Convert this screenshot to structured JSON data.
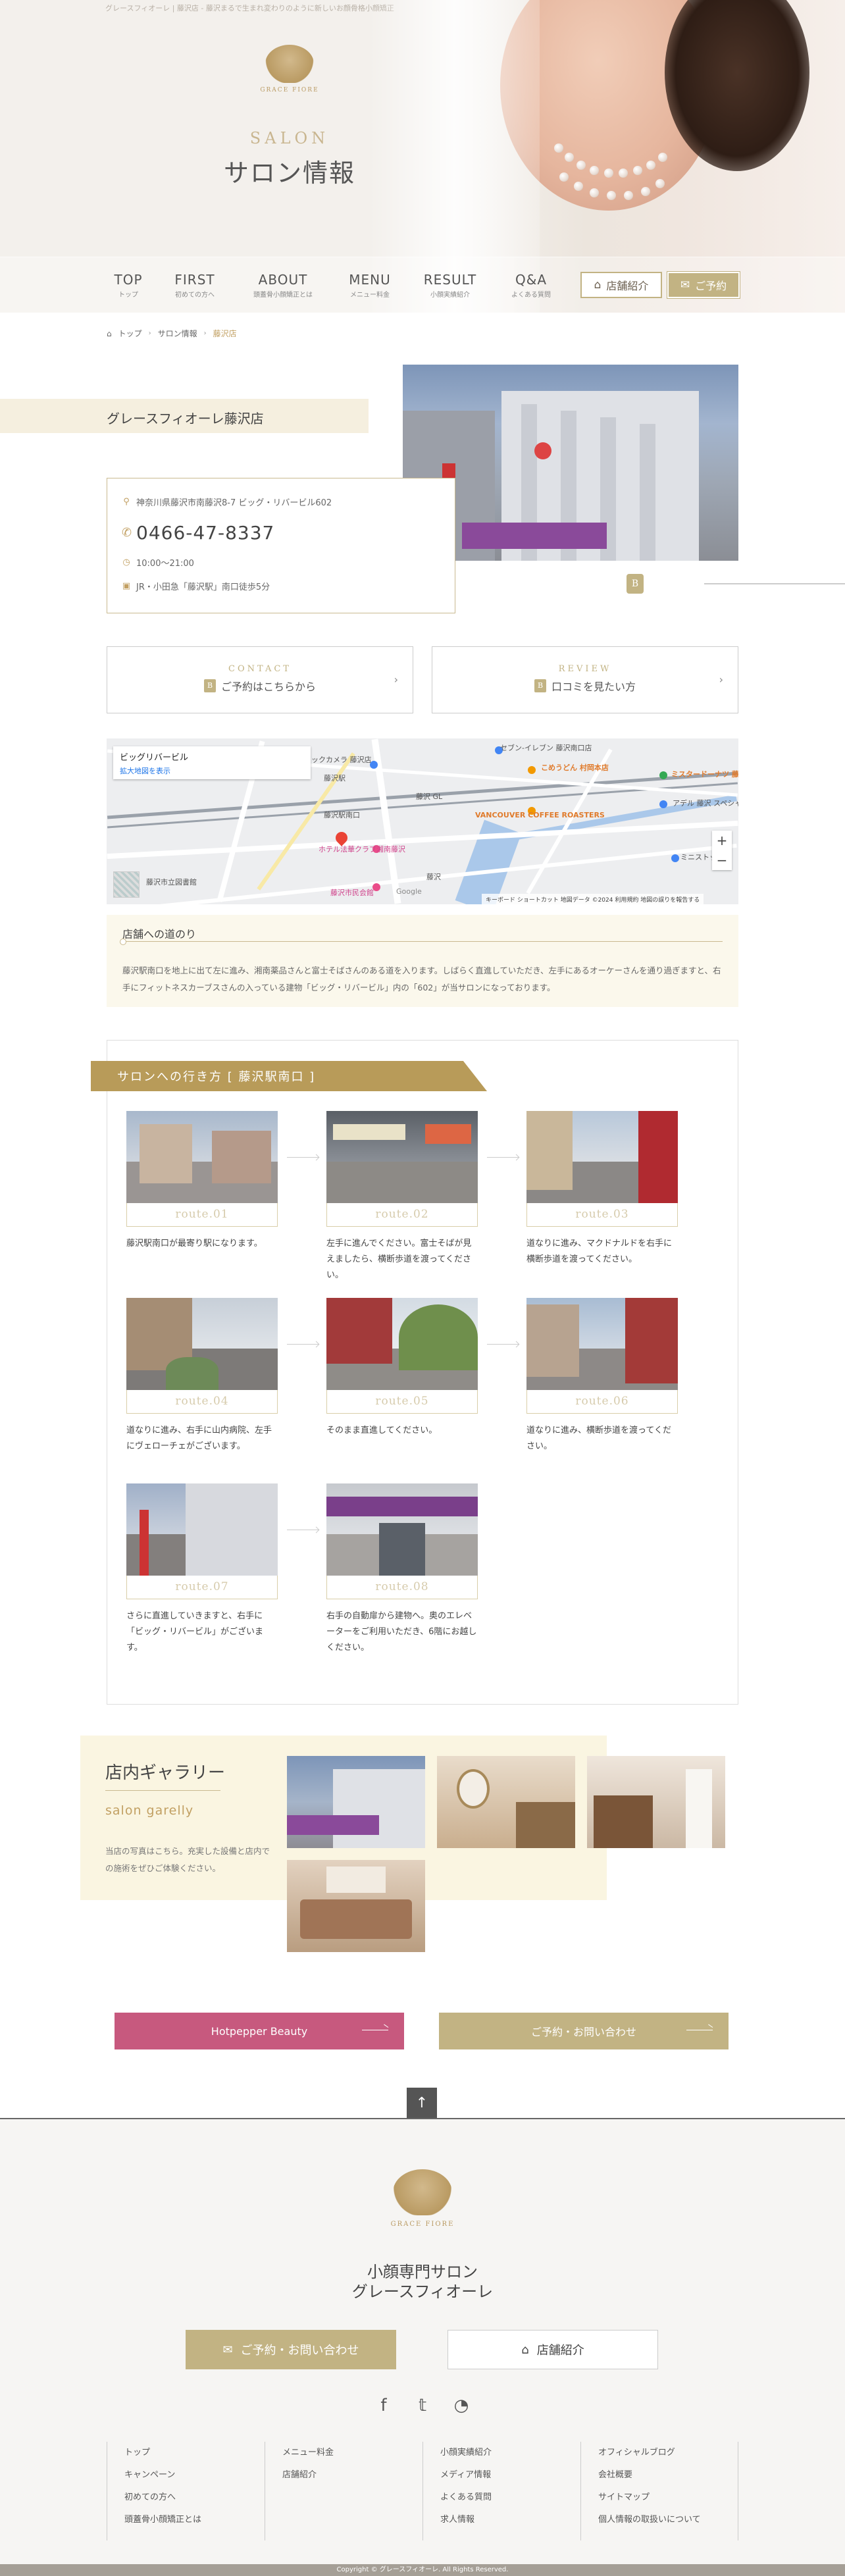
{
  "hero": {
    "tagline": "グレースフィオーレ | 藤沢店 - 藤沢まるで生まれ変わりのように新しいお顔骨格小顔矯正",
    "logo_text": "GRACE FIORE",
    "title_en": "SALON",
    "title_jp": "サロン情報"
  },
  "nav": {
    "items": [
      {
        "main": "TOP",
        "sub": "トップ"
      },
      {
        "main": "FIRST",
        "sub": "初めての方へ"
      },
      {
        "main": "ABOUT",
        "sub": "頭蓋骨小顔矯正とは"
      },
      {
        "main": "MENU",
        "sub": "メニュー料金"
      },
      {
        "main": "RESULT",
        "sub": "小顔実績紹介"
      },
      {
        "main": "Q&A",
        "sub": "よくある質問"
      }
    ],
    "shop_label": "店舗紹介",
    "reserve_label": "ご予約"
  },
  "breadcrumb": {
    "home": "トップ",
    "parent": "サロン情報",
    "current": "藤沢店"
  },
  "shop": {
    "name": "グレースフィオーレ藤沢店",
    "address": "神奈川県藤沢市南藤沢8-7 ビッグ・リバービル602",
    "tel": "0466-47-8337",
    "hours": "10:00〜21:00",
    "access": "JR・小田急「藤沢駅」南口徒歩5分",
    "photo_badge": "B"
  },
  "cta": {
    "contact_en": "CONTACT",
    "contact_jp": "ご予約はこちらから",
    "review_en": "REVIEW",
    "review_jp": "口コミを見たい方",
    "badge": "B"
  },
  "map": {
    "place_name": "ビッグリバービル",
    "enlarge": "拡大地図を表示",
    "footer": "キーボード ショートカット  地図データ ©2024  利用規約  地図の誤りを報告する",
    "labels": [
      "セブン-イレブン 藤沢南口店",
      "ビックカメラ 藤沢店",
      "藤沢駅",
      "藤沢駅南口",
      "藤沢 GL",
      "こめうどん 村岡本店",
      "ミスタードーナツ 藤沢店",
      "VANCOUVER COFFEE ROASTERS",
      "アデル 藤沢 スペシャルショップ",
      "ホテル法華クラブ湘南藤沢",
      "藤沢市立図書館",
      "藤沢市民会館",
      "藤沢",
      "ミニストップ",
      "Google"
    ]
  },
  "route_desc": {
    "title": "店舗への道のり",
    "text": "藤沢駅南口を地上に出て左に進み、湘南薬品さんと富士そばさんのある道を入ります。しばらく直進していただき、左手にあるオーケーさんを通り過ぎますと、右手にフィットネスカーブスさんの入っている建物「ビッグ・リバービル」内の「602」が当サロンになっております。"
  },
  "steps": {
    "heading": "サロンへの行き方 [ 藤沢駅南口 ]",
    "items": [
      {
        "label": "route.01",
        "text": "藤沢駅南口が最寄り駅になります。"
      },
      {
        "label": "route.02",
        "text": "左手に進んでください。富士そばが見えましたら、横断歩道を渡ってください。"
      },
      {
        "label": "route.03",
        "text": "道なりに進み、マクドナルドを右手に横断歩道を渡ってください。"
      },
      {
        "label": "route.04",
        "text": "道なりに進み、右手に山内病院、左手にヴェローチェがございます。"
      },
      {
        "label": "route.05",
        "text": "そのまま直進してください。"
      },
      {
        "label": "route.06",
        "text": "道なりに進み、横断歩道を渡ってください。"
      },
      {
        "label": "route.07",
        "text": "さらに直進していきますと、右手に「ビッグ・リバービル」がございます。"
      },
      {
        "label": "route.08",
        "text": "右手の自動扉から建物へ。奥のエレベーターをご利用いただき、6階にお越しください。"
      }
    ]
  },
  "gallery": {
    "title": "店内ギャラリー",
    "subtitle": "salon garelly",
    "desc": "当店の写真はこちら。充実した設備と店内での施術をぜひご体験ください。"
  },
  "bottom": {
    "hotpepper": "Hotpepper Beauty",
    "reserve": "ご予約・お問い合わせ"
  },
  "totop": "↑",
  "footer": {
    "logo_text": "GRACE FIORE",
    "name1": "小顔専門サロン",
    "name2": "グレースフィオーレ",
    "contact_btn": "ご予約・お問い合わせ",
    "shop_btn": "店舗紹介",
    "cols": [
      [
        "トップ",
        "キャンペーン",
        "初めての方へ",
        "頭蓋骨小顔矯正とは"
      ],
      [
        "メニュー料金",
        "店舗紹介"
      ],
      [
        "小顔実績紹介",
        "メディア情報",
        "よくある質問",
        "求人情報"
      ],
      [
        "オフィシャルブログ",
        "会社概要",
        "サイトマップ",
        "個人情報の取扱いについて"
      ]
    ],
    "copyright": "Copyright © グレースフィオーレ. All Rights Reserved."
  }
}
